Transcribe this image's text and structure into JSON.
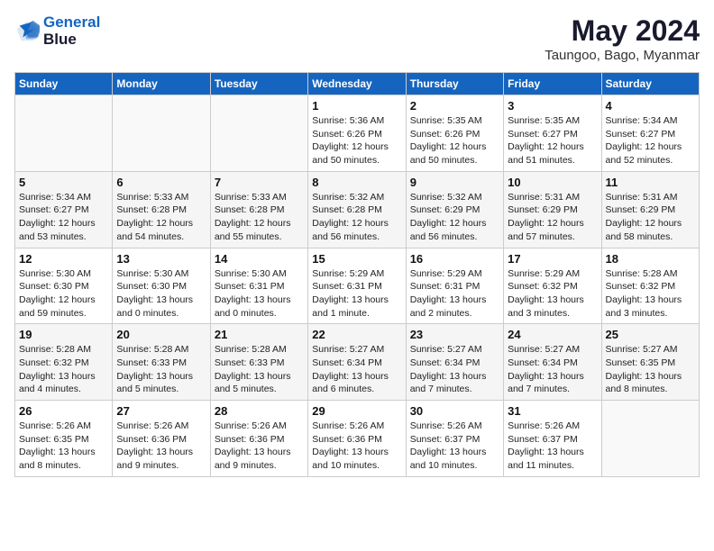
{
  "header": {
    "logo_line1": "General",
    "logo_line2": "Blue",
    "month_year": "May 2024",
    "location": "Taungoo, Bago, Myanmar"
  },
  "weekdays": [
    "Sunday",
    "Monday",
    "Tuesday",
    "Wednesday",
    "Thursday",
    "Friday",
    "Saturday"
  ],
  "weeks": [
    [
      {
        "day": "",
        "info": ""
      },
      {
        "day": "",
        "info": ""
      },
      {
        "day": "",
        "info": ""
      },
      {
        "day": "1",
        "info": "Sunrise: 5:36 AM\nSunset: 6:26 PM\nDaylight: 12 hours\nand 50 minutes."
      },
      {
        "day": "2",
        "info": "Sunrise: 5:35 AM\nSunset: 6:26 PM\nDaylight: 12 hours\nand 50 minutes."
      },
      {
        "day": "3",
        "info": "Sunrise: 5:35 AM\nSunset: 6:27 PM\nDaylight: 12 hours\nand 51 minutes."
      },
      {
        "day": "4",
        "info": "Sunrise: 5:34 AM\nSunset: 6:27 PM\nDaylight: 12 hours\nand 52 minutes."
      }
    ],
    [
      {
        "day": "5",
        "info": "Sunrise: 5:34 AM\nSunset: 6:27 PM\nDaylight: 12 hours\nand 53 minutes."
      },
      {
        "day": "6",
        "info": "Sunrise: 5:33 AM\nSunset: 6:28 PM\nDaylight: 12 hours\nand 54 minutes."
      },
      {
        "day": "7",
        "info": "Sunrise: 5:33 AM\nSunset: 6:28 PM\nDaylight: 12 hours\nand 55 minutes."
      },
      {
        "day": "8",
        "info": "Sunrise: 5:32 AM\nSunset: 6:28 PM\nDaylight: 12 hours\nand 56 minutes."
      },
      {
        "day": "9",
        "info": "Sunrise: 5:32 AM\nSunset: 6:29 PM\nDaylight: 12 hours\nand 56 minutes."
      },
      {
        "day": "10",
        "info": "Sunrise: 5:31 AM\nSunset: 6:29 PM\nDaylight: 12 hours\nand 57 minutes."
      },
      {
        "day": "11",
        "info": "Sunrise: 5:31 AM\nSunset: 6:29 PM\nDaylight: 12 hours\nand 58 minutes."
      }
    ],
    [
      {
        "day": "12",
        "info": "Sunrise: 5:30 AM\nSunset: 6:30 PM\nDaylight: 12 hours\nand 59 minutes."
      },
      {
        "day": "13",
        "info": "Sunrise: 5:30 AM\nSunset: 6:30 PM\nDaylight: 13 hours\nand 0 minutes."
      },
      {
        "day": "14",
        "info": "Sunrise: 5:30 AM\nSunset: 6:31 PM\nDaylight: 13 hours\nand 0 minutes."
      },
      {
        "day": "15",
        "info": "Sunrise: 5:29 AM\nSunset: 6:31 PM\nDaylight: 13 hours\nand 1 minute."
      },
      {
        "day": "16",
        "info": "Sunrise: 5:29 AM\nSunset: 6:31 PM\nDaylight: 13 hours\nand 2 minutes."
      },
      {
        "day": "17",
        "info": "Sunrise: 5:29 AM\nSunset: 6:32 PM\nDaylight: 13 hours\nand 3 minutes."
      },
      {
        "day": "18",
        "info": "Sunrise: 5:28 AM\nSunset: 6:32 PM\nDaylight: 13 hours\nand 3 minutes."
      }
    ],
    [
      {
        "day": "19",
        "info": "Sunrise: 5:28 AM\nSunset: 6:32 PM\nDaylight: 13 hours\nand 4 minutes."
      },
      {
        "day": "20",
        "info": "Sunrise: 5:28 AM\nSunset: 6:33 PM\nDaylight: 13 hours\nand 5 minutes."
      },
      {
        "day": "21",
        "info": "Sunrise: 5:28 AM\nSunset: 6:33 PM\nDaylight: 13 hours\nand 5 minutes."
      },
      {
        "day": "22",
        "info": "Sunrise: 5:27 AM\nSunset: 6:34 PM\nDaylight: 13 hours\nand 6 minutes."
      },
      {
        "day": "23",
        "info": "Sunrise: 5:27 AM\nSunset: 6:34 PM\nDaylight: 13 hours\nand 7 minutes."
      },
      {
        "day": "24",
        "info": "Sunrise: 5:27 AM\nSunset: 6:34 PM\nDaylight: 13 hours\nand 7 minutes."
      },
      {
        "day": "25",
        "info": "Sunrise: 5:27 AM\nSunset: 6:35 PM\nDaylight: 13 hours\nand 8 minutes."
      }
    ],
    [
      {
        "day": "26",
        "info": "Sunrise: 5:26 AM\nSunset: 6:35 PM\nDaylight: 13 hours\nand 8 minutes."
      },
      {
        "day": "27",
        "info": "Sunrise: 5:26 AM\nSunset: 6:36 PM\nDaylight: 13 hours\nand 9 minutes."
      },
      {
        "day": "28",
        "info": "Sunrise: 5:26 AM\nSunset: 6:36 PM\nDaylight: 13 hours\nand 9 minutes."
      },
      {
        "day": "29",
        "info": "Sunrise: 5:26 AM\nSunset: 6:36 PM\nDaylight: 13 hours\nand 10 minutes."
      },
      {
        "day": "30",
        "info": "Sunrise: 5:26 AM\nSunset: 6:37 PM\nDaylight: 13 hours\nand 10 minutes."
      },
      {
        "day": "31",
        "info": "Sunrise: 5:26 AM\nSunset: 6:37 PM\nDaylight: 13 hours\nand 11 minutes."
      },
      {
        "day": "",
        "info": ""
      }
    ]
  ]
}
